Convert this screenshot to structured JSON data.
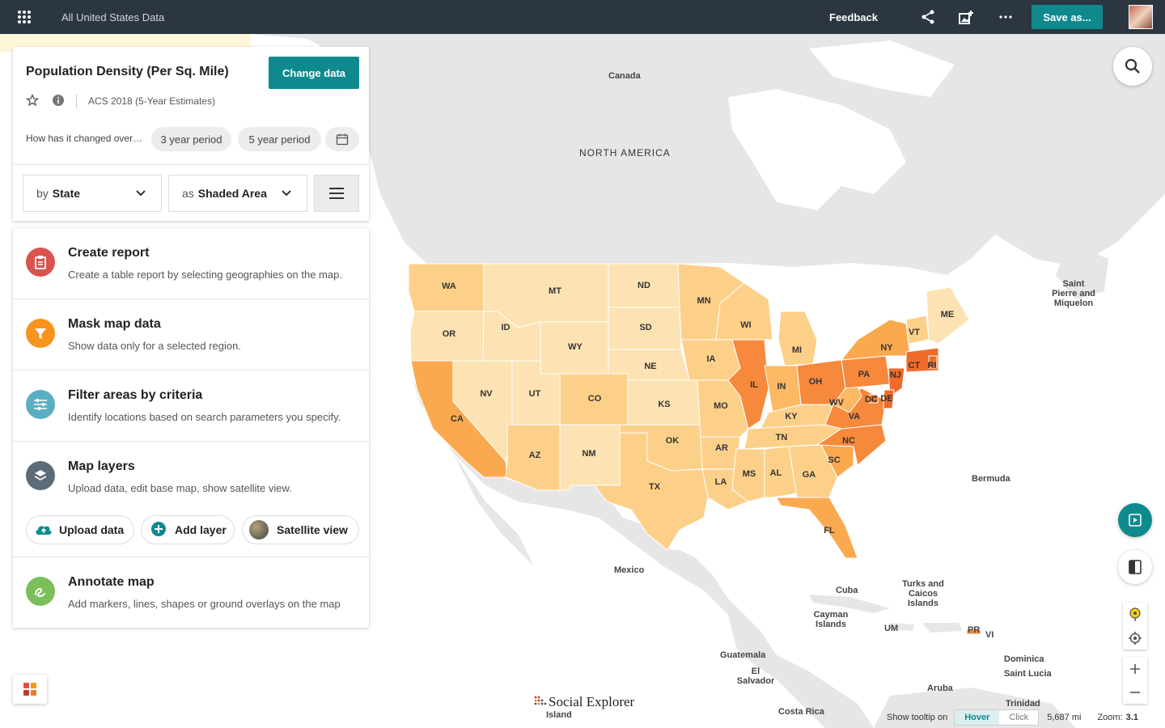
{
  "topbar": {
    "title": "All United States Data",
    "feedback": "Feedback",
    "save_as": "Save as..."
  },
  "data_card": {
    "title": "Population Density (Per Sq. Mile)",
    "change_data": "Change data",
    "source": "ACS 2018 (5-Year Estimates)",
    "change_question": "How has it changed over…",
    "chip_3yr": "3 year period",
    "chip_5yr": "5 year period",
    "by_prefix": "by",
    "by_value": "State",
    "as_prefix": "as",
    "as_value": "Shaded Area"
  },
  "tools": {
    "create_report": {
      "title": "Create report",
      "desc": "Create a table report by selecting geographies on the map."
    },
    "mask": {
      "title": "Mask map data",
      "desc": "Show data only for a selected region."
    },
    "filter": {
      "title": "Filter areas by criteria",
      "desc": "Identify locations based on search parameters you specify."
    },
    "layers": {
      "title": "Map layers",
      "desc": "Upload data, edit base map, show satellite view."
    },
    "annotate": {
      "title": "Annotate map",
      "desc": "Add markers, lines, shapes or ground overlays on the map"
    },
    "upload_data": "Upload data",
    "add_layer": "Add layer",
    "satellite_view": "Satellite view"
  },
  "map_labels": {
    "canada": "Canada",
    "north_america": "NORTH AMERICA",
    "mexico": "Mexico",
    "bermuda": "Bermuda",
    "saint_pierre": "Saint\nPierre and\nMiquelon",
    "cuba": "Cuba",
    "cayman": "Cayman\nIslands",
    "um": "UM",
    "turks": "Turks and\nCaicos\nIslands",
    "pr": "PR",
    "vi": "VI",
    "guatemala": "Guatemala",
    "el_salvador": "El\nSalvador",
    "dominica": "Dominica",
    "saint_lucia": "Saint Lucia",
    "aruba": "Aruba",
    "costa_rica": "Costa Rica",
    "trinidad": "Trinidad",
    "island": "Island"
  },
  "states": [
    "WA",
    "OR",
    "CA",
    "MT",
    "ID",
    "NV",
    "WY",
    "UT",
    "AZ",
    "CO",
    "NM",
    "ND",
    "SD",
    "NE",
    "KS",
    "OK",
    "TX",
    "MN",
    "IA",
    "MO",
    "AR",
    "LA",
    "WI",
    "IL",
    "MI",
    "IN",
    "OH",
    "KY",
    "TN",
    "MS",
    "AL",
    "GA",
    "FL",
    "SC",
    "NC",
    "VA",
    "WV",
    "PA",
    "NY",
    "VT",
    "ME",
    "NJ",
    "DE",
    "DC",
    "CT",
    "RI"
  ],
  "brand": {
    "logo_text": "Social Explorer"
  },
  "status": {
    "tooltip_label": "Show tooltip on",
    "hover": "Hover",
    "click": "Click",
    "scale": "5,687 mi",
    "zoom_label": "Zoom:",
    "zoom_value": "3.1"
  },
  "colors": {
    "accent": "#0e8a8f",
    "topbar": "#2b3640",
    "shade_1": "#fde3b3",
    "shade_2": "#fdd08a",
    "shade_3": "#fdb863",
    "shade_4": "#fba94f",
    "shade_5": "#f6893c",
    "shade_6": "#ef6b2a"
  }
}
